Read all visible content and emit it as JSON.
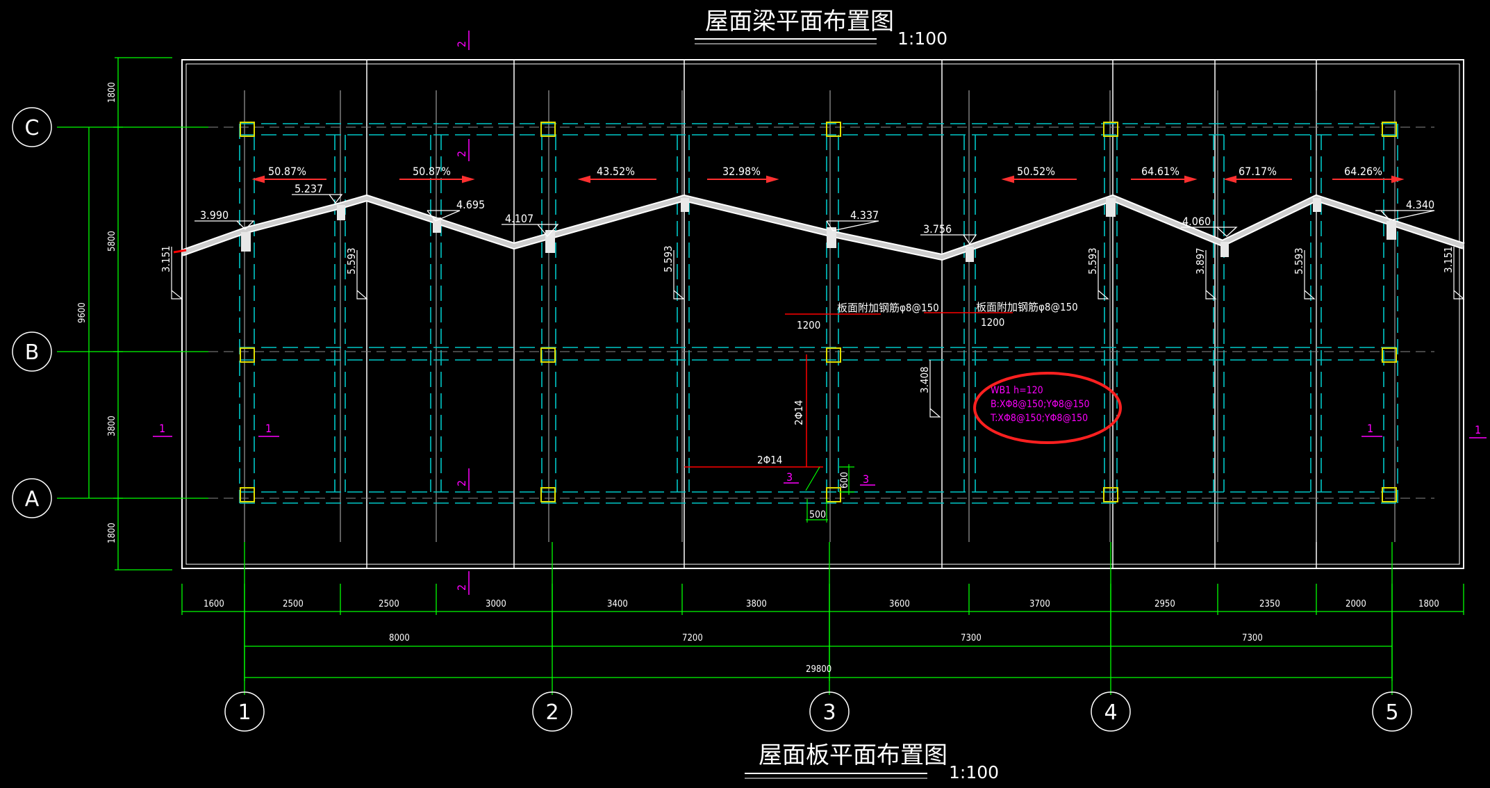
{
  "titles": {
    "top": "屋面梁平面布置图",
    "top_scale": "1:100",
    "bottom": "屋面板平面布置图",
    "bottom_scale": "1:100"
  },
  "axes": {
    "rows": [
      "C",
      "B",
      "A"
    ],
    "cols": [
      "1",
      "2",
      "3",
      "4",
      "5"
    ]
  },
  "dims_left": [
    "1800",
    "5800",
    "9600",
    "3800",
    "1800"
  ],
  "dims_bottom_detail": [
    "1600",
    "2500",
    "2500",
    "3000",
    "3400",
    "3800",
    "3600",
    "3700",
    "2950",
    "2350",
    "2000",
    "1800"
  ],
  "dims_bottom_mid": [
    "8000",
    "7200",
    "7300",
    "7300"
  ],
  "dim_total": "29800",
  "slopes": [
    "50.87%",
    "50.87%",
    "43.52%",
    "32.98%",
    "50.52%",
    "64.61%",
    "67.17%",
    "64.26%"
  ],
  "roof_elevations": [
    "3.990",
    "5.237",
    "4.695",
    "4.107",
    "4.337",
    "3.756",
    "4.060",
    "4.340"
  ],
  "vertical_elevations": [
    "3.151",
    "5.593",
    "5.593",
    "5.593",
    "3.897",
    "5.593",
    "3.151",
    "3.408"
  ],
  "notes": {
    "rebar_a": "板面附加钢筋φ8@150",
    "rebar_a_len": "1200",
    "rebar_b": "板面附加钢筋φ8@150",
    "rebar_b_len": "1200",
    "bar_vertical": "2Φ14",
    "bar_horizontal": "2Φ14",
    "dim_600": "600",
    "dim_500": "500",
    "sec3_left": "3",
    "sec3_right": "3"
  },
  "slab": {
    "line1": "WB1 h=120",
    "line2": "B:XΦ8@150;YΦ8@150",
    "line3": "T:XΦ8@150;YΦ8@150"
  },
  "section_marks": {
    "two": "2",
    "one": "1"
  },
  "colors": {
    "background": "#000000",
    "axis_green": "#00ff00",
    "beam_cyan": "#00c8c8",
    "column_yellow": "#e0e000",
    "annotation_magenta": "#ff00ff",
    "rebar_red": "#ff0000",
    "line_white": "#ffffff",
    "highlight_circle": "#ff2020"
  }
}
